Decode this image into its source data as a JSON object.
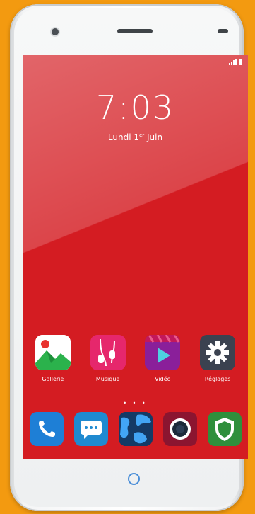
{
  "lockscreen": {
    "time": "7:03",
    "date_prefix": "Lundi 1",
    "date_suffix": "er",
    "date_month": "Juin"
  },
  "colors": {
    "screen_bg": "#d41c22",
    "frame": "#f39a10",
    "home_button": "#4a8ed8"
  },
  "apps": [
    {
      "label": "Gallerie",
      "icon": "gallery-icon"
    },
    {
      "label": "Musique",
      "icon": "music-icon"
    },
    {
      "label": "Vidéo",
      "icon": "video-icon"
    },
    {
      "label": "Réglages",
      "icon": "settings-icon"
    }
  ],
  "page_indicator": "• • •",
  "dock": [
    {
      "icon": "phone-icon"
    },
    {
      "icon": "messages-icon"
    },
    {
      "icon": "browser-globe-icon"
    },
    {
      "icon": "camera-icon"
    },
    {
      "icon": "security-shield-icon"
    }
  ]
}
